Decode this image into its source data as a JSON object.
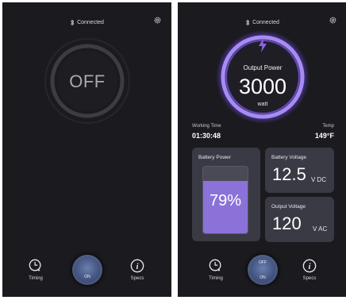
{
  "left_screen": {
    "status": {
      "label": "Connected"
    },
    "dial": {
      "label": "OFF"
    },
    "bottom": {
      "timing_label": "Timing",
      "specs_label": "Specs",
      "switch_on_label": "ON"
    }
  },
  "right_screen": {
    "status": {
      "label": "Connected"
    },
    "dial": {
      "caption": "Output Power",
      "value": "3000",
      "unit": "watt"
    },
    "working_time": {
      "label": "Working Time",
      "value": "01:30:48"
    },
    "temp": {
      "label": "Temp",
      "value": "149°F"
    },
    "battery_power": {
      "title": "Battery Power",
      "value": "79%",
      "level": 0.79
    },
    "battery_voltage": {
      "title": "Battery Voltage",
      "value": "12.5",
      "unit": "V DC"
    },
    "output_voltage": {
      "title": "Output Voltage",
      "value": "120",
      "unit": "V AC"
    },
    "bottom": {
      "timing_label": "Timing",
      "specs_label": "Specs",
      "switch_off_label": "OFF",
      "switch_on_label": "ON"
    }
  },
  "colors": {
    "background": "#1a1a1f",
    "card": "#3a3a44",
    "accent": "#8b72d8",
    "ring_off": "#3c3c44"
  },
  "icons": {
    "status": "bluetooth-icon",
    "settings": "gear-icon",
    "power": "bolt-icon",
    "timing": "clock-alarm-icon",
    "specs": "info-icon"
  }
}
